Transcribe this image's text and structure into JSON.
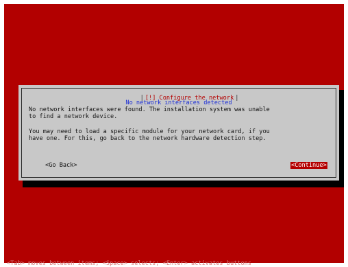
{
  "dialog": {
    "title": "[!] Configure the network",
    "subtitle": "No network interfaces detected",
    "paragraphs": [
      [
        "No network interfaces were found. The installation system was unable",
        "to find a network device."
      ],
      [
        "You may need to load a specific module for your network card, if you",
        "have one. For this, go back to the network hardware detection step."
      ]
    ],
    "buttons": {
      "back": "<Go Back>",
      "continue": "<Continue>"
    }
  },
  "footer": "<Tab> moves between items; <Space> selects; <Enter> activates buttons",
  "colors": {
    "background": "#b20000",
    "dialog": "#c8c8c8",
    "title": "#b40000",
    "subtitle": "#1d2fd6",
    "button_selected": "#b40000"
  }
}
